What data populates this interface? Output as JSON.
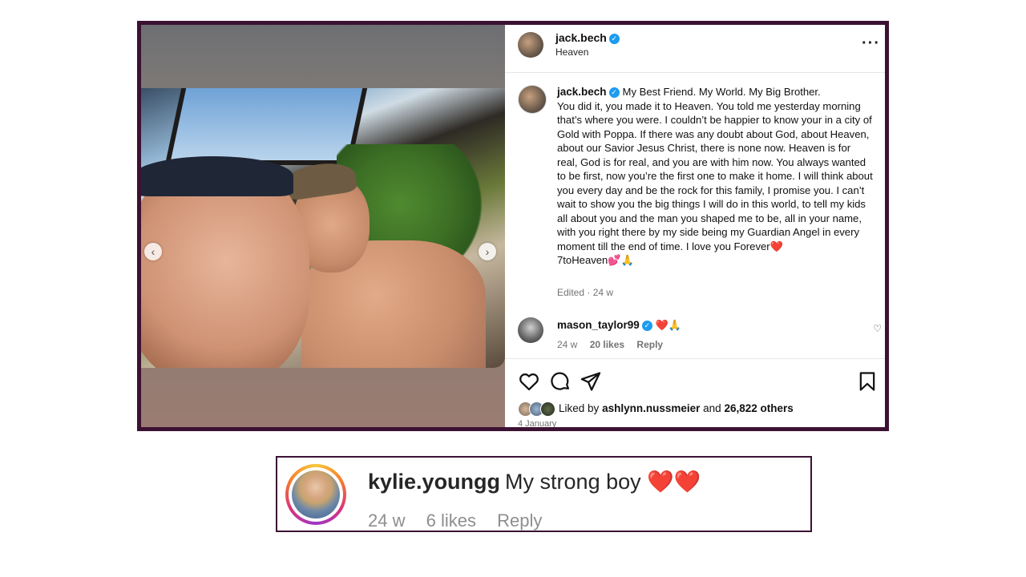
{
  "post": {
    "username": "jack.bech",
    "location": "Heaven",
    "more_icon": "more-options-icon",
    "caption_heading": "My Best Friend. My World. My Big Brother.",
    "caption_body": "You did it, you made it to Heaven. You told me yesterday morning that’s where you were. I couldn’t be happier to know your in a city of Gold with Poppa. If there was any doubt about God, about Heaven, about our Savior Jesus Christ, there is none now. Heaven is for real, God is for real, and you are with him now. You always wanted to be first, now you’re the first one to make it home. I will think about you every day and be the rock for this family, I promise you. I can’t wait to show you the big things I will do in this world, to tell my kids all about you and the man you shaped me to be, all in your name, with you right there by my side being my Guardian Angel in every moment till the end of time. I love you Forever❤️\n7toHeaven💕🙏",
    "caption_meta": "Edited · 24 w",
    "comment": {
      "username": "mason_taylor99",
      "text": "❤️🙏",
      "time": "24 w",
      "likes": "20 likes",
      "reply": "Reply"
    },
    "liked_by_prefix": "Liked by",
    "liked_by_user": "ashlynn.nussmeier",
    "liked_by_and": "and",
    "liked_by_others": "26,822 others",
    "date": "4 January"
  },
  "callout": {
    "username": "kylie.youngg",
    "text": "My strong boy ❤️❤️",
    "time": "24 w",
    "likes": "6 likes",
    "reply": "Reply"
  },
  "colors": {
    "frame": "#3c1233",
    "verified": "#1d9bf0",
    "muted": "#737373"
  }
}
